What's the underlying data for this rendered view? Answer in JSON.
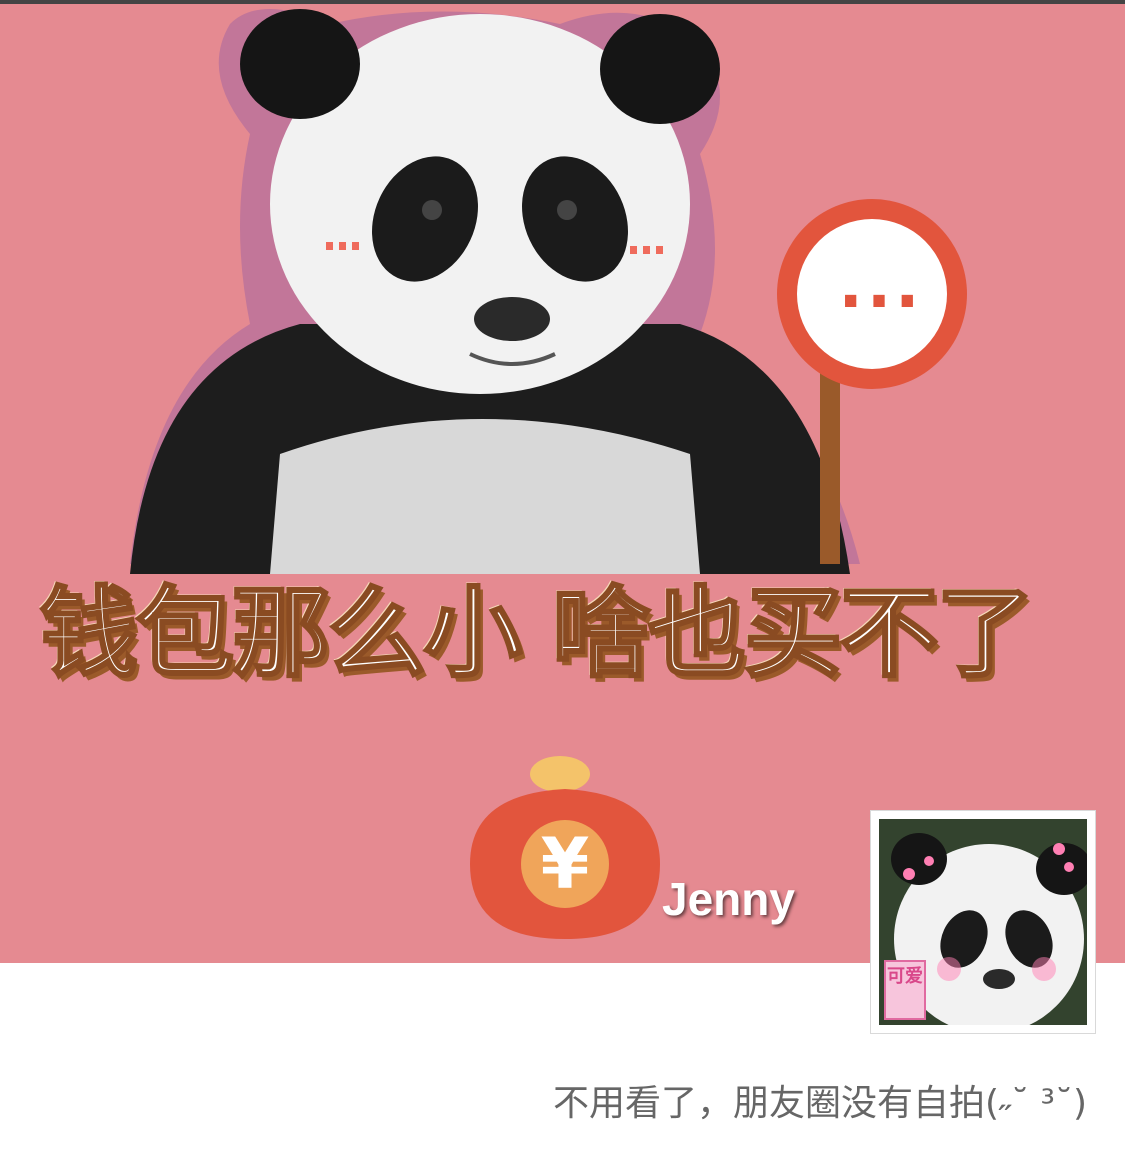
{
  "cover": {
    "caption": "钱包那么小 啥也买不了",
    "sign_text": "...",
    "purse_symbol": "¥",
    "accent_color": "#e58a91"
  },
  "profile": {
    "username": "Jenny",
    "avatar_tag": "可爱",
    "signature": "不用看了，朋友圈没有自拍(˶˘ ³˘)"
  }
}
